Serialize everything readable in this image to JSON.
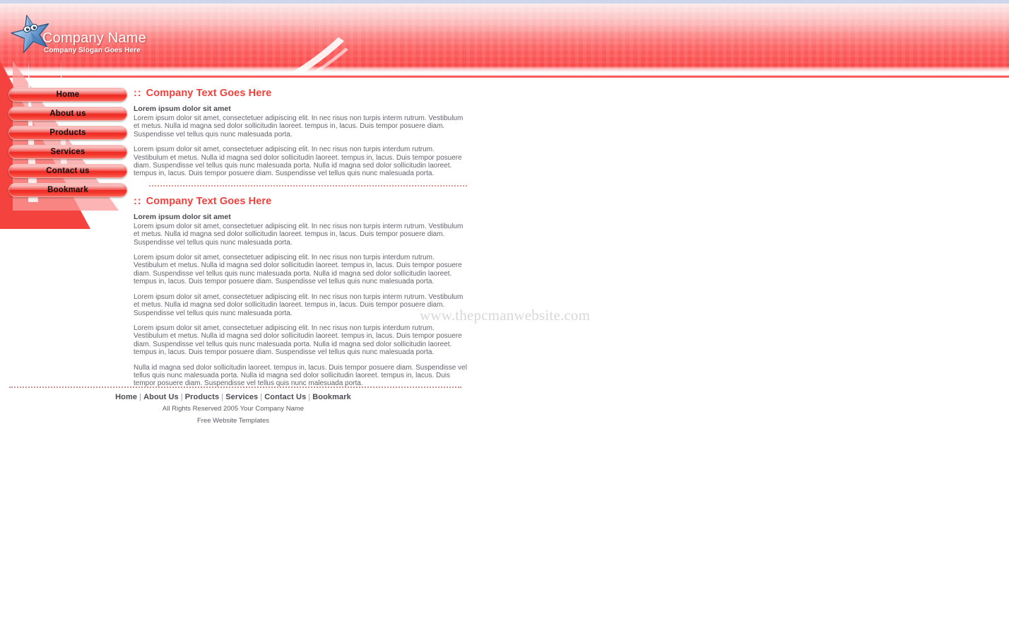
{
  "brand": {
    "name": "Company Name",
    "slogan": "Company Slogan Goes Here",
    "logo_icon": "star-icon"
  },
  "colors": {
    "accent_red": "#f2413c",
    "header_red": "#fa5050",
    "body_text": "#63636b",
    "heading_text": "#4b4b53",
    "top_rule": "#ccd6ea"
  },
  "nav": {
    "items": [
      {
        "label": "Home",
        "name": "nav-home"
      },
      {
        "label": "About us",
        "name": "nav-about-us"
      },
      {
        "label": "Products",
        "name": "nav-products"
      },
      {
        "label": "Services",
        "name": "nav-services"
      },
      {
        "label": "Contact us",
        "name": "nav-contact-us"
      },
      {
        "label": "Bookmark",
        "name": "nav-bookmark"
      }
    ]
  },
  "content": {
    "sections": [
      {
        "colons": "::",
        "title": "Company Text Goes Here",
        "subtitle": "Lorem ipsum dolor sit amet",
        "paragraphs": [
          "Lorem ipsum dolor sit amet, consectetuer adipiscing elit. In nec risus non turpis interm rutrum. Vestibulum et metus. Nulla id magna sed dolor sollicitudin laoreet. tempus in, lacus. Duis tempor posuere diam. Suspendisse vel tellus quis nunc malesuada porta.",
          "Lorem ipsum dolor sit amet, consectetuer adipiscing elit. In nec risus non turpis interdum rutrum. Vestibulum et metus. Nulla id magna sed dolor sollicitudin laoreet. tempus in, lacus. Duis tempor posuere diam. Suspendisse vel tellus quis nunc malesuada porta. Nulla id magna sed dolor sollicitudin laoreet. tempus in, lacus. Duis tempor posuere diam. Suspendisse vel tellus quis nunc malesuada porta."
        ]
      },
      {
        "colons": "::",
        "title": "Company Text Goes Here",
        "subtitle": "Lorem ipsum dolor sit amet",
        "paragraphs": [
          "Lorem ipsum dolor sit amet, consectetuer adipiscing elit. In nec risus non turpis interm rutrum. Vestibulum et metus. Nulla id magna sed dolor sollicitudin laoreet. tempus in, lacus. Duis tempor posuere diam. Suspendisse vel tellus quis nunc malesuada porta.",
          "Lorem ipsum dolor sit amet, consectetuer adipiscing elit. In nec risus non turpis interdum rutrum. Vestibulum et metus. Nulla id magna sed dolor sollicitudin laoreet. tempus in, lacus. Duis tempor posuere diam. Suspendisse vel tellus quis nunc malesuada porta. Nulla id magna sed dolor sollicitudin laoreet. tempus in, lacus. Duis tempor posuere diam. Suspendisse vel tellus quis nunc malesuada porta.",
          "Lorem ipsum dolor sit amet, consectetuer adipiscing elit. In nec risus non turpis interm rutrum. Vestibulum et metus. Nulla id magna sed dolor sollicitudin laoreet. tempus in, lacus. Duis tempor posuere diam. Suspendisse vel tellus quis nunc malesuada porta.",
          "Lorem ipsum dolor sit amet, consectetuer adipiscing elit. In nec risus non turpis interdum rutrum. Vestibulum et metus. Nulla id magna sed dolor sollicitudin laoreet. tempus in, lacus. Duis tempor posuere diam. Suspendisse vel tellus quis nunc malesuada porta. Nulla id magna sed dolor sollicitudin laoreet. tempus in, lacus. Duis tempor posuere diam. Suspendisse vel tellus quis nunc malesuada porta.",
          "Nulla id magna sed dolor sollicitudin laoreet. tempus in, lacus. Duis tempor posuere diam. Suspendisse vel tellus quis nunc malesuada porta. Nulla id magna sed dolor sollicitudin laoreet. tempus in, lacus. Duis tempor posuere diam. Suspendisse vel tellus quis nunc malesuada porta."
        ]
      }
    ]
  },
  "footer": {
    "links": [
      {
        "label": "Home"
      },
      {
        "label": "About Us"
      },
      {
        "label": "Products"
      },
      {
        "label": "Services"
      },
      {
        "label": "Contact Us"
      },
      {
        "label": "Bookmark"
      }
    ],
    "separator": "|",
    "copyright": "All Rights Reserved 2005 Your Company Name",
    "credit": "Free Website Templates"
  },
  "watermark": {
    "text": "www.thepcmanwebsite.com"
  }
}
